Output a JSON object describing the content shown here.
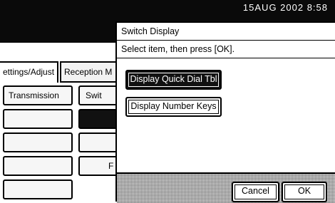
{
  "status": {
    "datetime": "15AUG  2002  8:58"
  },
  "background": {
    "tabs": [
      {
        "label": "ettings/Adjust"
      },
      {
        "label": "Reception M"
      }
    ],
    "cells": {
      "transmission": "Transmission",
      "switch": "Swit",
      "f": "F"
    }
  },
  "dialog": {
    "title": "Switch Display",
    "instruction": "Select item, then press [OK].",
    "options": [
      {
        "label": "Display Quick Dial Tbl",
        "selected": true
      },
      {
        "label": "Display Number Keys",
        "selected": false
      }
    ],
    "buttons": {
      "cancel": "Cancel",
      "ok": "OK"
    }
  },
  "colors": {
    "dark": "#0a0a0a",
    "selected_bg": "#111111",
    "footer_pattern": "#e6e6e6"
  }
}
